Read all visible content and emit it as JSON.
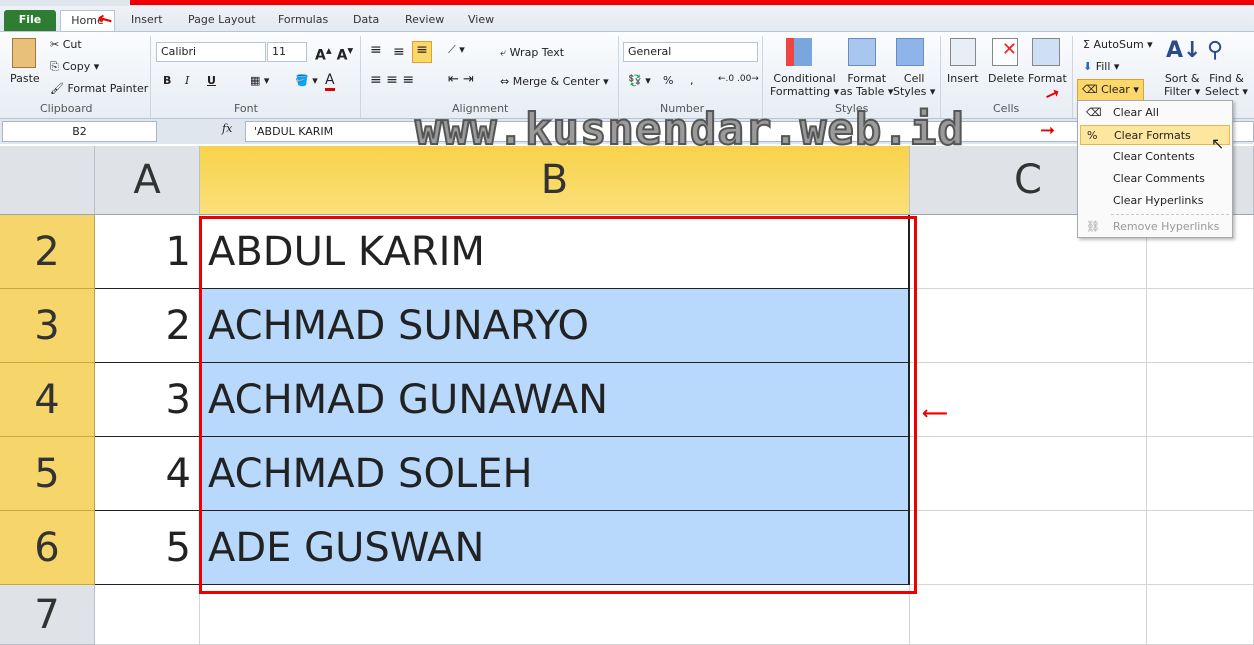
{
  "tabs": [
    "File",
    "Home",
    "Insert",
    "Page Layout",
    "Formulas",
    "Data",
    "Review",
    "View"
  ],
  "clipboard": {
    "paste": "Paste",
    "cut": "Cut",
    "copy": "Copy",
    "format_painter": "Format Painter",
    "group": "Clipboard"
  },
  "font": {
    "name": "Calibri",
    "size": "11",
    "group": "Font",
    "bold": "B",
    "italic": "I",
    "underline": "U"
  },
  "alignment": {
    "wrap": "Wrap Text",
    "merge": "Merge & Center",
    "group": "Alignment"
  },
  "number": {
    "format": "General",
    "percent": "%",
    "comma": ",",
    "group": "Number"
  },
  "styles": {
    "conditional": "Conditional",
    "conditional2": "Formatting",
    "format_table": "Format",
    "format_table2": "as Table",
    "cell_styles": "Cell",
    "cell_styles2": "Styles",
    "group": "Styles"
  },
  "cells": {
    "insert": "Insert",
    "delete": "Delete",
    "format": "Format",
    "group": "Cells"
  },
  "editing": {
    "autosum": "AutoSum",
    "fill": "Fill",
    "clear": "Clear",
    "sort": "Sort &",
    "sort2": "Filter",
    "find": "Find &",
    "find2": "Select"
  },
  "formula_bar": {
    "name_box": "B2",
    "fx": "fx",
    "value": "'ABDUL KARIM"
  },
  "watermark": "www.kusnendar.web.id",
  "columns": [
    "A",
    "B",
    "C"
  ],
  "rows": [
    {
      "n": "2",
      "a": "1",
      "b": "ABDUL KARIM"
    },
    {
      "n": "3",
      "a": "2",
      "b": "ACHMAD SUNARYO"
    },
    {
      "n": "4",
      "a": "3",
      "b": "ACHMAD GUNAWAN"
    },
    {
      "n": "5",
      "a": "4",
      "b": "ACHMAD SOLEH"
    },
    {
      "n": "6",
      "a": "5",
      "b": "ADE GUSWAN"
    },
    {
      "n": "7",
      "a": "",
      "b": ""
    }
  ],
  "clear_menu": [
    "Clear All",
    "Clear Formats",
    "Clear Contents",
    "Clear Comments",
    "Clear Hyperlinks",
    "Remove Hyperlinks"
  ],
  "colors": {
    "selection": "#b8d9fb",
    "highlight_red": "#e00000",
    "header_selected": "#f6d66b"
  }
}
